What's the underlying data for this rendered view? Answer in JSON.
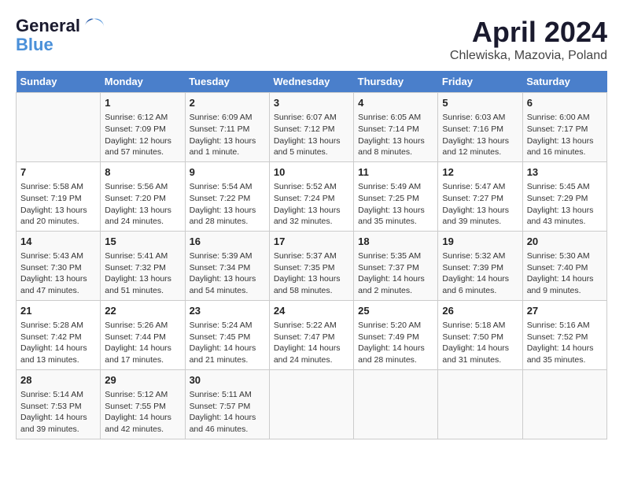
{
  "logo": {
    "line1": "General",
    "line2": "Blue"
  },
  "title": "April 2024",
  "subtitle": "Chlewiska, Mazovia, Poland",
  "days_of_week": [
    "Sunday",
    "Monday",
    "Tuesday",
    "Wednesday",
    "Thursday",
    "Friday",
    "Saturday"
  ],
  "weeks": [
    [
      {
        "day": "",
        "content": ""
      },
      {
        "day": "1",
        "content": "Sunrise: 6:12 AM\nSunset: 7:09 PM\nDaylight: 12 hours\nand 57 minutes."
      },
      {
        "day": "2",
        "content": "Sunrise: 6:09 AM\nSunset: 7:11 PM\nDaylight: 13 hours\nand 1 minute."
      },
      {
        "day": "3",
        "content": "Sunrise: 6:07 AM\nSunset: 7:12 PM\nDaylight: 13 hours\nand 5 minutes."
      },
      {
        "day": "4",
        "content": "Sunrise: 6:05 AM\nSunset: 7:14 PM\nDaylight: 13 hours\nand 8 minutes."
      },
      {
        "day": "5",
        "content": "Sunrise: 6:03 AM\nSunset: 7:16 PM\nDaylight: 13 hours\nand 12 minutes."
      },
      {
        "day": "6",
        "content": "Sunrise: 6:00 AM\nSunset: 7:17 PM\nDaylight: 13 hours\nand 16 minutes."
      }
    ],
    [
      {
        "day": "7",
        "content": "Sunrise: 5:58 AM\nSunset: 7:19 PM\nDaylight: 13 hours\nand 20 minutes."
      },
      {
        "day": "8",
        "content": "Sunrise: 5:56 AM\nSunset: 7:20 PM\nDaylight: 13 hours\nand 24 minutes."
      },
      {
        "day": "9",
        "content": "Sunrise: 5:54 AM\nSunset: 7:22 PM\nDaylight: 13 hours\nand 28 minutes."
      },
      {
        "day": "10",
        "content": "Sunrise: 5:52 AM\nSunset: 7:24 PM\nDaylight: 13 hours\nand 32 minutes."
      },
      {
        "day": "11",
        "content": "Sunrise: 5:49 AM\nSunset: 7:25 PM\nDaylight: 13 hours\nand 35 minutes."
      },
      {
        "day": "12",
        "content": "Sunrise: 5:47 AM\nSunset: 7:27 PM\nDaylight: 13 hours\nand 39 minutes."
      },
      {
        "day": "13",
        "content": "Sunrise: 5:45 AM\nSunset: 7:29 PM\nDaylight: 13 hours\nand 43 minutes."
      }
    ],
    [
      {
        "day": "14",
        "content": "Sunrise: 5:43 AM\nSunset: 7:30 PM\nDaylight: 13 hours\nand 47 minutes."
      },
      {
        "day": "15",
        "content": "Sunrise: 5:41 AM\nSunset: 7:32 PM\nDaylight: 13 hours\nand 51 minutes."
      },
      {
        "day": "16",
        "content": "Sunrise: 5:39 AM\nSunset: 7:34 PM\nDaylight: 13 hours\nand 54 minutes."
      },
      {
        "day": "17",
        "content": "Sunrise: 5:37 AM\nSunset: 7:35 PM\nDaylight: 13 hours\nand 58 minutes."
      },
      {
        "day": "18",
        "content": "Sunrise: 5:35 AM\nSunset: 7:37 PM\nDaylight: 14 hours\nand 2 minutes."
      },
      {
        "day": "19",
        "content": "Sunrise: 5:32 AM\nSunset: 7:39 PM\nDaylight: 14 hours\nand 6 minutes."
      },
      {
        "day": "20",
        "content": "Sunrise: 5:30 AM\nSunset: 7:40 PM\nDaylight: 14 hours\nand 9 minutes."
      }
    ],
    [
      {
        "day": "21",
        "content": "Sunrise: 5:28 AM\nSunset: 7:42 PM\nDaylight: 14 hours\nand 13 minutes."
      },
      {
        "day": "22",
        "content": "Sunrise: 5:26 AM\nSunset: 7:44 PM\nDaylight: 14 hours\nand 17 minutes."
      },
      {
        "day": "23",
        "content": "Sunrise: 5:24 AM\nSunset: 7:45 PM\nDaylight: 14 hours\nand 21 minutes."
      },
      {
        "day": "24",
        "content": "Sunrise: 5:22 AM\nSunset: 7:47 PM\nDaylight: 14 hours\nand 24 minutes."
      },
      {
        "day": "25",
        "content": "Sunrise: 5:20 AM\nSunset: 7:49 PM\nDaylight: 14 hours\nand 28 minutes."
      },
      {
        "day": "26",
        "content": "Sunrise: 5:18 AM\nSunset: 7:50 PM\nDaylight: 14 hours\nand 31 minutes."
      },
      {
        "day": "27",
        "content": "Sunrise: 5:16 AM\nSunset: 7:52 PM\nDaylight: 14 hours\nand 35 minutes."
      }
    ],
    [
      {
        "day": "28",
        "content": "Sunrise: 5:14 AM\nSunset: 7:53 PM\nDaylight: 14 hours\nand 39 minutes."
      },
      {
        "day": "29",
        "content": "Sunrise: 5:12 AM\nSunset: 7:55 PM\nDaylight: 14 hours\nand 42 minutes."
      },
      {
        "day": "30",
        "content": "Sunrise: 5:11 AM\nSunset: 7:57 PM\nDaylight: 14 hours\nand 46 minutes."
      },
      {
        "day": "",
        "content": ""
      },
      {
        "day": "",
        "content": ""
      },
      {
        "day": "",
        "content": ""
      },
      {
        "day": "",
        "content": ""
      }
    ]
  ]
}
